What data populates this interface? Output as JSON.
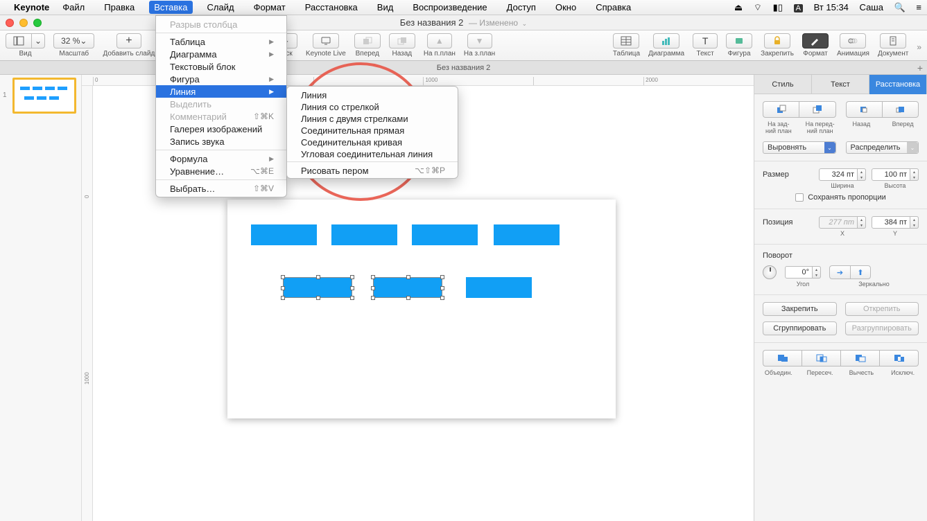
{
  "menubar": {
    "app": "Keynote",
    "items": [
      "Файл",
      "Правка",
      "Вставка",
      "Слайд",
      "Формат",
      "Расстановка",
      "Вид",
      "Воспроизведение",
      "Доступ",
      "Окно",
      "Справка"
    ],
    "active_index": 2,
    "clock": "Вт 15:34",
    "user": "Саша"
  },
  "window": {
    "title": "Без названия 2",
    "modified": "— Изменено"
  },
  "toolbar": {
    "zoom": "32 %",
    "view": "Вид",
    "scale": "Масштаб",
    "add_slide": "Добавить слайд",
    "play": "Пуск",
    "keynote_live": "Keynote Live",
    "forward": "Вперед",
    "backward": "Назад",
    "to_front": "На п.план",
    "to_back": "На з.план",
    "table": "Таблица",
    "chart": "Диаграмма",
    "text": "Текст",
    "shape": "Фигура",
    "lock": "Закрепить",
    "format": "Формат",
    "animate": "Анимация",
    "document": "Документ"
  },
  "doctab": "Без названия 2",
  "dropdown": {
    "section_break": "Разрыв столбца",
    "table": "Таблица",
    "chart": "Диаграмма",
    "text_block": "Текстовый блок",
    "shape": "Фигура",
    "line": "Линия",
    "highlight": "Выделить",
    "comment": "Комментарий",
    "comment_sc": "⇧⌘K",
    "gallery": "Галерея изображений",
    "record_audio": "Запись звука",
    "formula": "Формула",
    "equation": "Уравнение…",
    "equation_sc": "⌥⌘E",
    "choose": "Выбрать…",
    "choose_sc": "⇧⌘V"
  },
  "submenu": {
    "line": "Линия",
    "arrow": "Линия со стрелкой",
    "double_arrow": "Линия с двумя стрелками",
    "connector_straight": "Соединительная прямая",
    "connector_curve": "Соединительная кривая",
    "connector_elbow": "Угловая соединительная линия",
    "draw_pen": "Рисовать пером",
    "draw_pen_sc": "⌥⇧⌘P"
  },
  "ruler": {
    "marks": [
      "0",
      "1000",
      "2000"
    ],
    "v0": "0",
    "v1000": "1000"
  },
  "slide_num": "1",
  "inspector": {
    "tabs": [
      "Стиль",
      "Текст",
      "Расстановка"
    ],
    "active_tab": 2,
    "to_back": "На зад-\nний план",
    "to_front": "На перед-\nний план",
    "backward": "Назад",
    "forward": "Вперед",
    "align": "Выровнять",
    "distribute": "Распределить",
    "size_label": "Размер",
    "width_val": "324 пт",
    "height_val": "100 пт",
    "width_lbl": "Ширина",
    "height_lbl": "Высота",
    "keep_ratio": "Сохранять пропорции",
    "pos_label": "Позиция",
    "x_val": "277 пт",
    "y_val": "384 пт",
    "x_lbl": "X",
    "y_lbl": "Y",
    "rotate_label": "Поворот",
    "angle_val": "0°",
    "angle_lbl": "Угол",
    "mirror_lbl": "Зеркально",
    "lock": "Закрепить",
    "unlock": "Открепить",
    "group": "Сгруппировать",
    "ungroup": "Разгруппировать",
    "bool_union": "Объедин.",
    "bool_intersect": "Пересеч.",
    "bool_subtract": "Вычесть",
    "bool_exclude": "Исключ."
  }
}
